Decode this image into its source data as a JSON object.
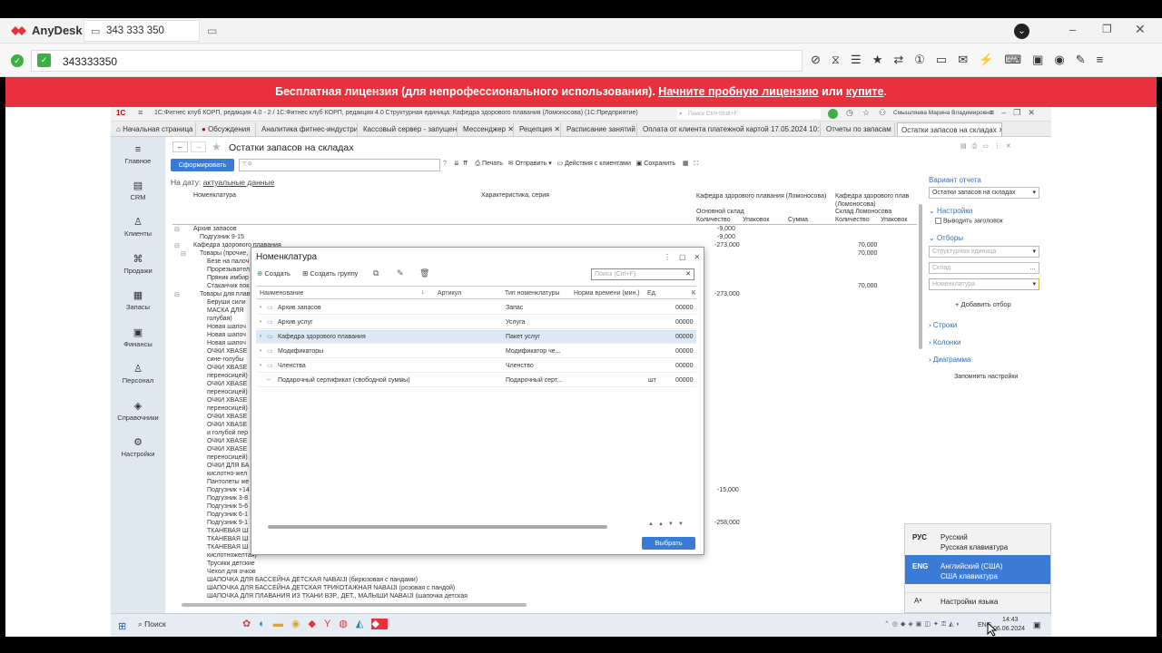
{
  "anydesk": {
    "app_name": "AnyDesk",
    "tab_id": "343 333 350",
    "address": "343333350",
    "banner": {
      "text1": "Бесплатная лицензия (для непрофессионального использования).",
      "link1": "Начните пробную лицензию",
      "text2": "или",
      "link2": "купите",
      "text3": "."
    }
  },
  "onec": {
    "title": "1С:Фитнес клуб КОРП, редакция 4.0 - 2 / 1С:Фитнес клуб КОРП, редакция 4.0 Структурная единица: Кафедра здорового плавания (Ломоносова)  (1С:Предприятие)",
    "search_placeholder": "Поиск Ctrl+Shift+F",
    "user": "Смышляева Марина Владимировна",
    "tabs": [
      "Начальная страница",
      "Обсуждения",
      "Аналитика фитнес-индустрии",
      "Кассовый сервер - запущен",
      "Мессенджер",
      "Рецепция",
      "Расписание занятий",
      "Оплата от клиента платежной картой 17.05.2024 10:14:02",
      "Отчеты по запасам",
      "Остатки запасов на складах"
    ],
    "sidebar": [
      "Главное",
      "CRM",
      "Клиенты",
      "Продажи",
      "Запасы",
      "Финансы",
      "Персонал",
      "Справочники",
      "Настройки"
    ],
    "report": {
      "title": "Остатки запасов на складах",
      "form_button": "Сформировать",
      "form_field_placeholder": "Т.Ф",
      "toolbar": {
        "print": "Печать",
        "send": "Отправить",
        "client_actions": "Действия с клиентами",
        "save": "Сохранить"
      },
      "date_label": "На дату:",
      "date_value": "актуальные данные",
      "col_nomenclature": "Номенклатура",
      "col_char": "Характеристика, серия",
      "col_dept1": "Кафедра здорового плавания (Ломоносова)",
      "col_dept2": "Кафедра здорового плав (Ломоносова)",
      "col_wh1": "Основной склад",
      "col_wh2": "Склад Ломоносова",
      "col_qty": "Количество",
      "col_pack": "Упаковок",
      "col_sum": "Сумма",
      "col_qty2": "Количество",
      "col_pack2": "Упаковок",
      "rows": [
        "Архив запасов",
        "Подгузник 9-15",
        "Кафедра здорового плавания",
        "Товары (прочие,",
        "Безе на палоч",
        "Прорезывател",
        "Пряник имбир",
        "Стаканчик пок",
        "Товары для плав",
        "Беруши сили",
        "МАСКА ДЛЯ",
        "голубая)",
        "Новая шапоч",
        "Новая шапоч",
        "Новая шапоч",
        "ОЧКИ XBASE",
        "сине-голубы",
        "ОЧКИ XBASE",
        "переносицей)",
        "ОЧКИ XBASE",
        "переносицей)",
        "ОЧКИ XBASE",
        "переносицей)",
        "ОЧКИ XBASE",
        "ОЧКИ XBASE",
        "и голубой пер",
        "ОЧКИ XBASE",
        "ОЧКИ XBASE",
        "переносицей)",
        "ОЧКИ ДЛЯ БА",
        "кислотно-жел",
        "Пантолеты же",
        "Подгузник +14",
        "Подгузник 3-8",
        "Подгузник 5-6",
        "Подгузник 6-1",
        "Подгузник 9-1",
        "ТКАНЕВАЯ Ш",
        "ТКАНЕВАЯ Ш",
        "ТКАНЕВАЯ Ш",
        "кислотножелтая)",
        "Трусики детские",
        "Чехол для очков",
        "ШАПОЧКА ДЛЯ БАССЕЙНА ДЕТСКАЯ  NABAIJI (бирюзовая с пандами)",
        "ШАПОЧКА ДЛЯ БАССЕЙНА ДЕТСКАЯ ТРИКОТАЖНАЯ NABAIJI (розовая с пандой)",
        "ШАПОЧКА ДЛЯ ПЛАВАНИЯ ИЗ ТКАНИ ВЗР., ДЕТ., МАЛЫШИ NABAIJI (шапочка детская"
      ],
      "values": [
        "-9,000",
        "-9,000",
        "-273,000",
        "70,000",
        "70,000",
        "70,000",
        "-273,000",
        "-15,000",
        "-258,000"
      ]
    },
    "panel": {
      "variant_label": "Вариант отчета",
      "variant_value": "Остатки запасов на складах",
      "settings": "Настройки",
      "show_header": "Выводить заголовок",
      "filters": "Отборы",
      "filter1": "Структурная единица",
      "filter2": "Склад",
      "filter3": "Номенклатура",
      "add_filter": "+ Добавить отбор",
      "rows": "Строки",
      "columns": "Колонки",
      "diagram": "Диаграмма",
      "remember": "Запомнить настройки"
    }
  },
  "modal": {
    "title": "Номенклатура",
    "create": "Создать",
    "create_group": "Создать группу",
    "search_placeholder": "Поиск (Ctrl+F)",
    "columns": [
      "Наименование",
      "Артикул",
      "Тип номенклатуры",
      "Норма времени (мин.)",
      "Ед.",
      "К"
    ],
    "rows": [
      {
        "name": "Архив запасов",
        "type": "Запас",
        "unit": "",
        "code": "00000"
      },
      {
        "name": "Архив услуг",
        "type": "Услуга",
        "unit": "",
        "code": "00000"
      },
      {
        "name": "Кафедра здорового плавания",
        "type": "Пакет услуг",
        "unit": "",
        "code": "00000"
      },
      {
        "name": "Модификаторы",
        "type": "Модификатор че...",
        "unit": "",
        "code": "00000"
      },
      {
        "name": "Членства",
        "type": "Членство",
        "unit": "",
        "code": "00000"
      },
      {
        "name": "Подарочный сертификат (свободной суммы)",
        "type": "Подарочный серт...",
        "unit": "шт",
        "code": "00000"
      }
    ],
    "select_button": "Выбрать"
  },
  "language_popup": {
    "items": [
      {
        "code": "РУС",
        "name": "Русский",
        "kbd": "Русская клавиатура"
      },
      {
        "code": "ENG",
        "name": "Английский (США)",
        "kbd": "США клавиатура"
      }
    ],
    "settings": "Настройки языка"
  },
  "taskbar": {
    "search": "Поиск",
    "lang": "ENG",
    "time": "14:43",
    "date": "06.06.2024"
  }
}
